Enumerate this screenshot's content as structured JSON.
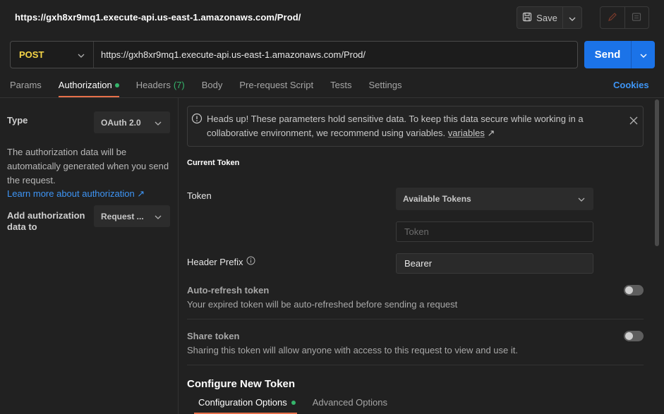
{
  "request": {
    "title": "https://gxh8xr9mq1.execute-api.us-east-1.amazonaws.com/Prod/",
    "method": "POST",
    "url": "https://gxh8xr9mq1.execute-api.us-east-1.amazonaws.com/Prod/"
  },
  "toolbar": {
    "save_label": "Save",
    "send_label": "Send"
  },
  "tabs": [
    {
      "label": "Params"
    },
    {
      "label": "Authorization",
      "active": true,
      "dot": true
    },
    {
      "label": "Headers",
      "count": "(7)"
    },
    {
      "label": "Body"
    },
    {
      "label": "Pre-request Script"
    },
    {
      "label": "Tests"
    },
    {
      "label": "Settings"
    }
  ],
  "cookies_label": "Cookies",
  "auth": {
    "type_label": "Type",
    "type_value": "OAuth 2.0",
    "description": "The authorization data will be automatically generated when you send the request.",
    "learn_more": "Learn more about authorization ↗",
    "add_to_label": "Add authorization data to",
    "add_to_value": "Request ..."
  },
  "banner": {
    "text": "Heads up! These parameters hold sensitive data. To keep this data secure while working in a collaborative environment, we recommend using variables.",
    "link": "variables",
    "link_arrow": "↗"
  },
  "current_token": {
    "heading": "Current Token",
    "token_label": "Token",
    "available_tokens": "Available Tokens",
    "token_placeholder": "Token",
    "header_prefix_label": "Header Prefix",
    "header_prefix_value": "Bearer",
    "auto_refresh_title": "Auto-refresh token",
    "auto_refresh_desc": "Your expired token will be auto-refreshed before sending a request",
    "auto_refresh_on": false,
    "share_title": "Share token",
    "share_desc": "Sharing this token will allow anyone with access to this request to view and use it.",
    "share_on": false
  },
  "configure": {
    "heading": "Configure New Token",
    "tabs": [
      {
        "label": "Configuration Options",
        "active": true,
        "dot": true
      },
      {
        "label": "Advanced Options"
      }
    ]
  },
  "colors": {
    "accent": "#1b73e8",
    "method": "#f5d547",
    "link": "#3e95f5",
    "active_tab": "#e6704a",
    "status_dot": "#35b56b"
  }
}
